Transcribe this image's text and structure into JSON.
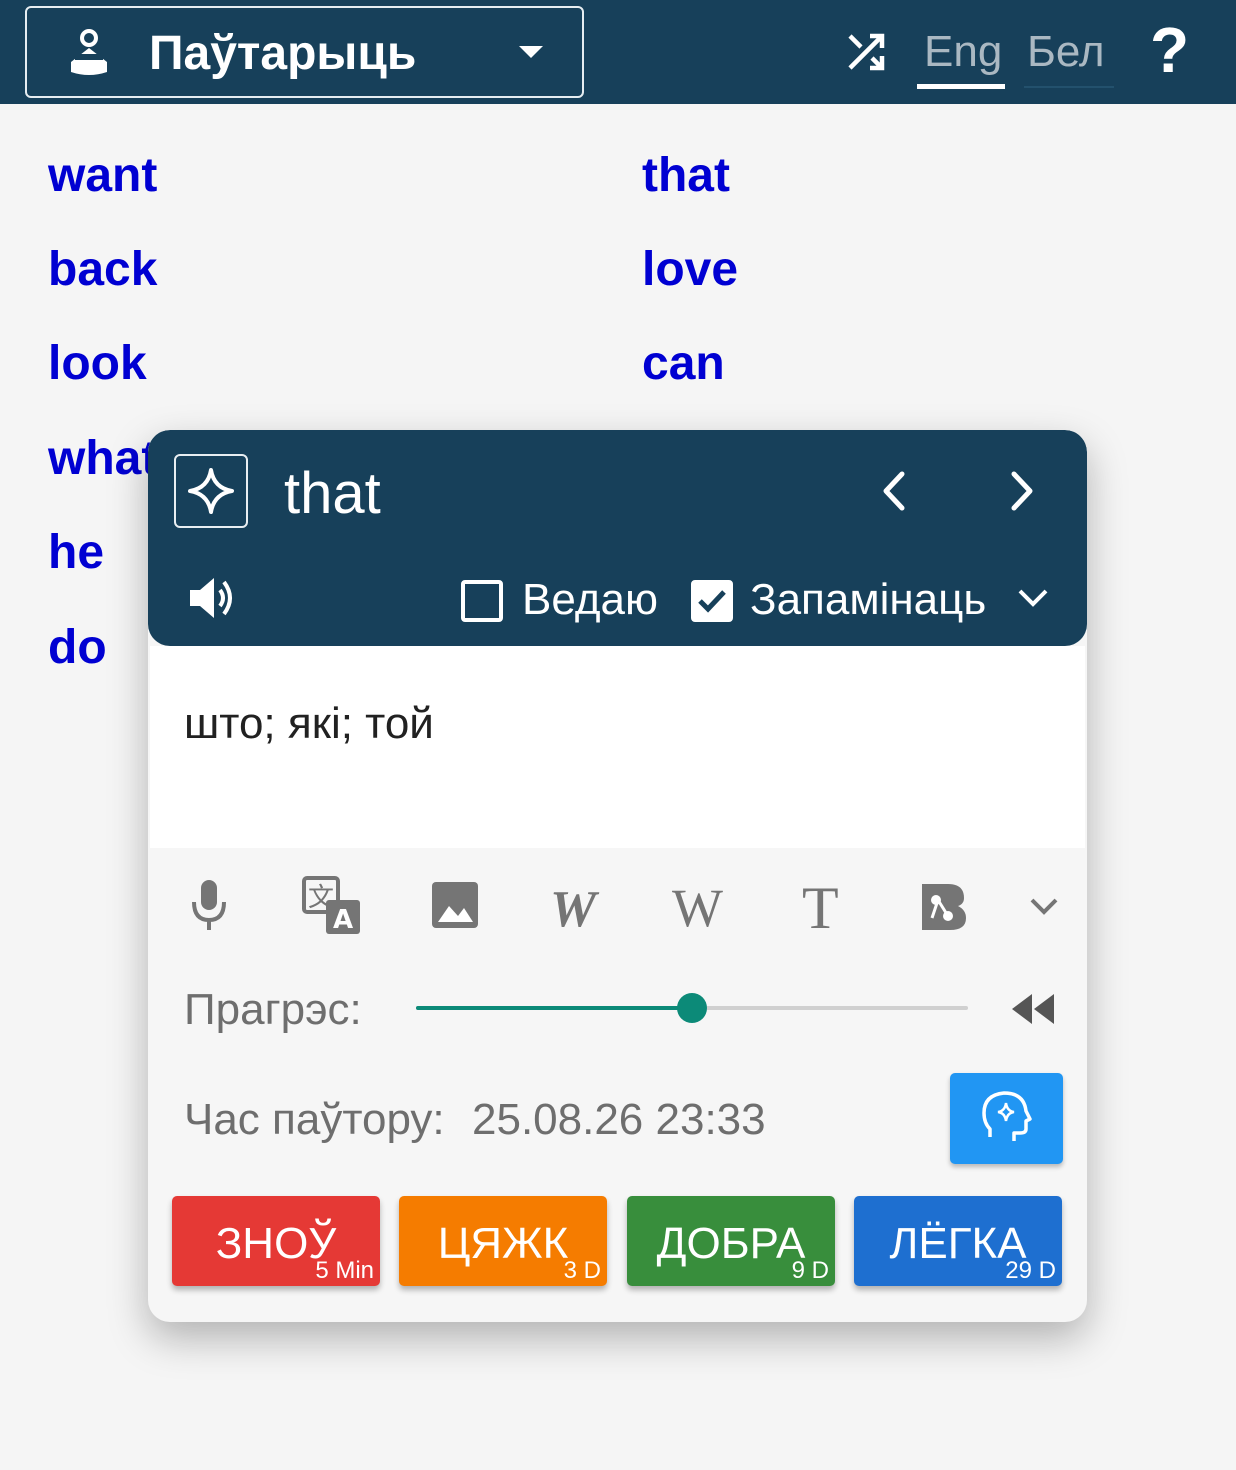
{
  "header": {
    "mode_label": "Паўтарыць",
    "lang_tabs": [
      "Eng",
      "Бел"
    ],
    "help_label": "?"
  },
  "words": {
    "left": [
      "want",
      "back",
      "look",
      "what",
      "he",
      "do"
    ],
    "right": [
      "that",
      "love",
      "can"
    ]
  },
  "card": {
    "word": "that",
    "known_label": "Ведаю",
    "known_checked": false,
    "memorize_label": "Запамінаць",
    "memorize_checked": true,
    "translation": "што; які; той",
    "progress_label": "Прагрэс:",
    "progress_value": 0.5,
    "review_time_label": "Час паўтору:",
    "review_time_value": "25.08.26 23:33",
    "tools": [
      "microphone-icon",
      "translate-icon",
      "image-icon",
      "wiktionary-icon",
      "wikipedia-icon",
      "typography-icon",
      "bee-icon",
      "chevron-down-icon"
    ],
    "answers": [
      {
        "label": "ЗНОЎ",
        "interval": "5 Min",
        "color": "#e53935"
      },
      {
        "label": "ЦЯЖК",
        "interval": "3 D",
        "color": "#f57c00"
      },
      {
        "label": "ДОБРА",
        "interval": "9 D",
        "color": "#388e3c"
      },
      {
        "label": "ЛЁГКА",
        "interval": "29 D",
        "color": "#1e6fd0"
      }
    ]
  },
  "colors": {
    "header_bg": "#17405a",
    "word_link": "#0000d2",
    "progress": "#0c8a78",
    "brain_button": "#2196f3"
  }
}
